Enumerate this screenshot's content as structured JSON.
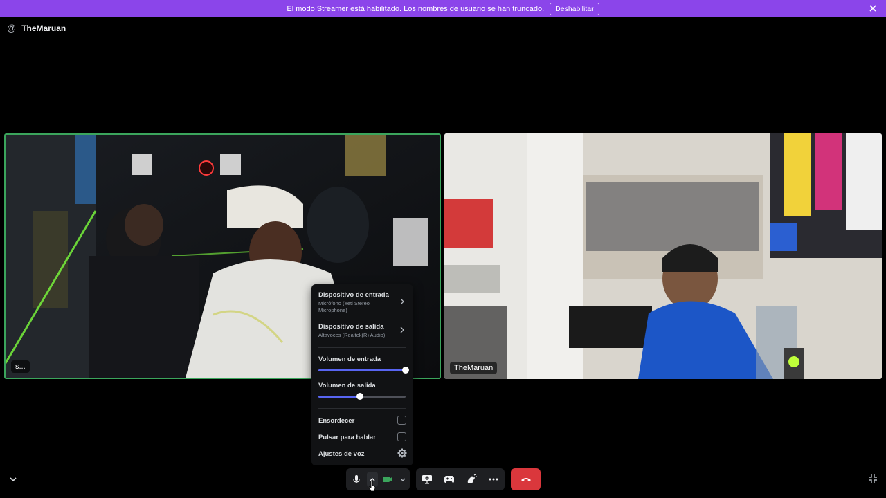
{
  "banner": {
    "message": "El modo Streamer está habilitado. Los nombres de usuario se han truncado.",
    "button_label": "Deshabilitar"
  },
  "header": {
    "at_symbol": "@",
    "channel_name": "TheMaruan"
  },
  "tiles": {
    "left_name": "s...",
    "right_name": "TheMaruan"
  },
  "audio_menu": {
    "input_device_title": "Dispositivo de entrada",
    "input_device_value": "Micrófono (Yeti Stereo Microphone)",
    "output_device_title": "Dispositivo de salida",
    "output_device_value": "Altavoces (Realtek(R) Audio)",
    "input_volume_label": "Volumen de entrada",
    "input_volume_value": 1.0,
    "output_volume_label": "Volumen de salida",
    "output_volume_value": 0.48,
    "deafen_label": "Ensordecer",
    "push_to_talk_label": "Pulsar para hablar",
    "voice_settings_label": "Ajustes de voz"
  },
  "colors": {
    "banner": "#8b45ea",
    "speaking_border": "#3ba55c",
    "slider_fill": "#5865f2",
    "hangup": "#da373c",
    "camera_on": "#3ba55c"
  },
  "icons": [
    "at-icon",
    "close-icon",
    "chevron-right-icon",
    "gear-icon",
    "microphone-icon",
    "chevron-up-icon",
    "camera-icon",
    "chevron-down-icon",
    "screen-share-icon",
    "activity-icon",
    "soundboard-icon",
    "more-icon",
    "hangup-icon",
    "fullscreen-icon"
  ]
}
